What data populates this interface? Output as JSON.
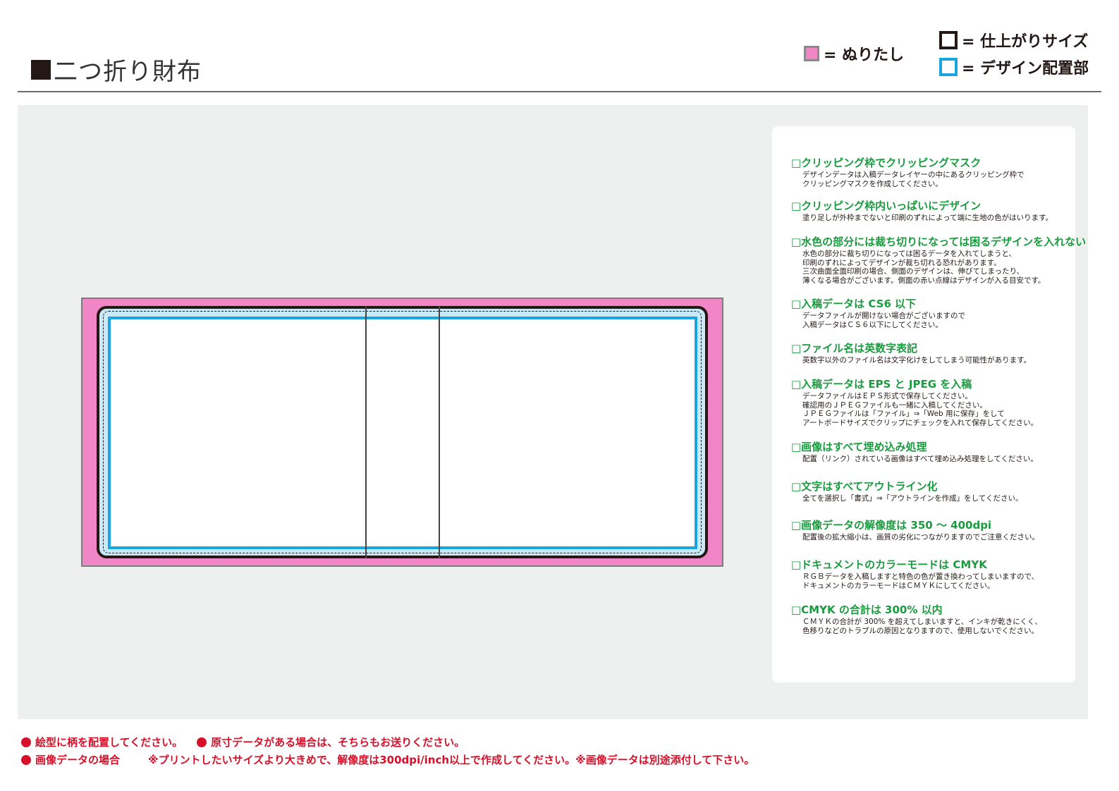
{
  "header": {
    "title": "二つ折り財布",
    "legend": {
      "bleed": "= ぬりたし",
      "trim": "= 仕上がりサイズ",
      "design": "= デザイン配置部"
    }
  },
  "colors": {
    "bleed": "#f086c6",
    "design_area": "#1aa5e0",
    "trim": "#231815",
    "checklist_heading": "#1a9b3f",
    "note": "#d7102a",
    "workarea": "#eeefef"
  },
  "checklist": [
    {
      "title": "□クリッピング枠でクリッピングマスク",
      "desc": "デザインデータは入稿データレイヤーの中にあるクリッピング枠で\nクリッピングマスクを作成してください。"
    },
    {
      "title": "□クリッピング枠内いっぱいにデザイン",
      "desc": "塗り足しが外枠までないと印刷のずれによって端に生地の色がはいります。"
    },
    {
      "title": "□水色の部分には裁ち切りになっては困るデザインを入れない",
      "desc": "水色の部分に裁ち切りになっては困るデータを入れてしまうと、\n印刷のずれによってデザインが裁ち切れる恐れがあります。\n三次曲面全面印刷の場合、側面のデザインは、伸びてしまったり、\n薄くなる場合がございます。側面の赤い点線はデザインが入る目安です。"
    },
    {
      "title": "□入稿データは CS6 以下",
      "desc": "データファイルが開けない場合がございますので\n入稿データはＣＳ６以下にしてください。"
    },
    {
      "title": "□ファイル名は英数字表記",
      "desc": "英数字以外のファイル名は文字化けをしてしまう可能性があります。"
    },
    {
      "title": "□入稿データは EPS と JPEG を入稿",
      "desc": "データファイルはＥＰＳ形式で保存してください。\n確認用のＪＰＥＧファイルも一緒に入稿してください。\nＪＰＥＧファイルは「ファイル」⇒「Web 用に保存」をして\nアートボードサイズでクリップにチェックを入れて保存してください。"
    },
    {
      "title": "□画像はすべて埋め込み処理",
      "desc": "配置（リンク）されている画像はすべて埋め込み処理をしてください。"
    },
    {
      "title": "□文字はすべてアウトライン化",
      "desc": "全てを選択し「書式」⇒「アウトラインを作成」をしてください。"
    },
    {
      "title": "□画像データの解像度は 350 ～ 400dpi",
      "desc": "配置後の拡大縮小は、画質の劣化につながりますのでご注意ください。"
    },
    {
      "title": "□ドキュメントのカラーモードは CMYK",
      "desc": "ＲＧＢデータを入稿しますと特色の色が置き換わってしまいますので、\nドキュメントのカラーモードはＣＭＹＫにしてください。"
    },
    {
      "title": "□CMYK の合計は 300% 以内",
      "desc": "ＣＭＹＫの合計が 300% を超えてしまいますと、インキが乾きにくく、\n色移りなどのトラブルの原因となりますので、使用しないでください。"
    }
  ],
  "notes": {
    "n1": "絵型に柄を配置してください。",
    "n2": "原寸データがある場合は、そちらもお送りください。",
    "n3": "画像データの場合",
    "n4": "※プリントしたいサイズより大きめで、解像度は300dpi/inch以上で作成してください。※画像データは別途添付して下さい。"
  }
}
